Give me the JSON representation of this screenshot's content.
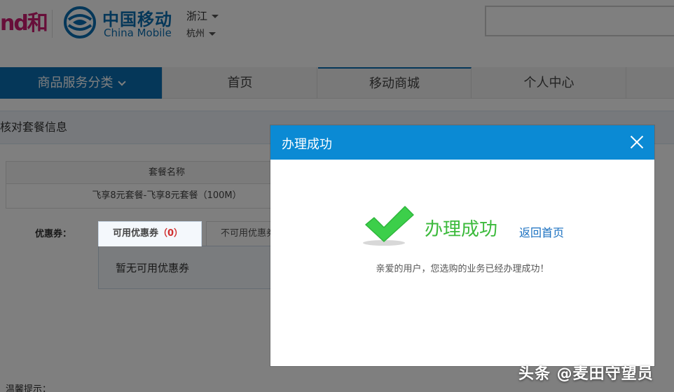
{
  "header": {
    "brand_left": "nd和",
    "logo_cn": "中国移动",
    "logo_en": "China Mobile",
    "province": "浙江",
    "city": "杭州"
  },
  "nav": {
    "category": "商品服务分类",
    "home": "首页",
    "mall": "移动商城",
    "personal": "个人中心"
  },
  "content": {
    "section_title": "核对套餐信息",
    "table_header": "套餐名称",
    "package_name": "飞享8元套餐-飞享8元套餐（100M）",
    "coupon_label": "优惠券：",
    "tab_available": "可用优惠券",
    "tab_available_count": "（0）",
    "tab_unavailable": "不可用优惠券",
    "no_coupon": "暂无可用优惠券",
    "tip": "温馨提示："
  },
  "dialog": {
    "title": "办理成功",
    "success_text": "办理成功",
    "back_link": "返回首页",
    "message": "亲爱的用户，您选购的业务已经办理成功！"
  },
  "watermark": "头条 @麦田守望员",
  "colors": {
    "brand_blue": "#0a6fb3",
    "dialog_header": "#0b8ad4",
    "success_green": "#3cba3c",
    "link_blue": "#1a70c0"
  }
}
